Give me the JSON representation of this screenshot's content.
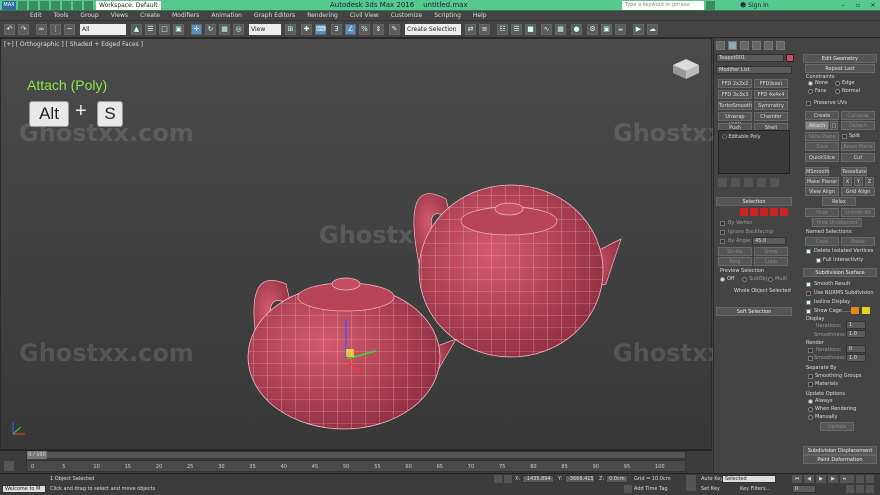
{
  "app": {
    "logo": "MAX",
    "workspace": "Workspace: Default",
    "title": "Autodesk 3ds Max 2016",
    "filename": "untitled.max",
    "search_placeholder": "Type a keyword or phrase",
    "sign_in": "Sign In",
    "window_controls": [
      "–",
      "▫",
      "✕"
    ]
  },
  "menu": [
    "Edit",
    "Tools",
    "Group",
    "Views",
    "Create",
    "Modifiers",
    "Animation",
    "Graph Editors",
    "Rendering",
    "Civil View",
    "Customize",
    "Scripting",
    "Help"
  ],
  "toolbar": {
    "selection_filter": "All",
    "ref_coord": "View",
    "named_selection": "Create Selection Se"
  },
  "viewport": {
    "label": "[+] [ Orthographic ] [ Shaded + Edged Faces ]",
    "overlay_title": "Attach (Poly)",
    "key1": "Alt",
    "key2": "S",
    "watermark": "Ghostxx.com"
  },
  "command_panel": {
    "object_name": "Teapot001",
    "modifier_list": "Modifier List",
    "modifier_buttons": [
      "FFD 2x2x2",
      "FFD(box)",
      "FFD 3x3x3",
      "FFD 4x4x4",
      "TurboSmooth",
      "Symmetry",
      "Unwrap UVW",
      "Chamfer",
      "Push",
      "Shell"
    ],
    "stack_item": "Editable Poly",
    "selection": {
      "header": "Selection",
      "by_vertex": "By Vertex",
      "ignore_backfacing": "Ignore Backfacing",
      "by_angle": "By Angle:",
      "angle_value": "45.0",
      "shrink": "Shrink",
      "grow": "Grow",
      "ring": "Ring",
      "loop": "Loop",
      "preview_selection": "Preview Selection",
      "preview_off": "Off",
      "preview_subobj": "SubObj",
      "preview_multi": "Multi",
      "whole_object": "Whole Object Selected"
    },
    "soft_selection": "Soft Selection",
    "edit_geometry": {
      "header": "Edit Geometry",
      "repeat_last": "Repeat Last",
      "constraints": "Constraints",
      "none": "None",
      "edge": "Edge",
      "face": "Face",
      "normal": "Normal",
      "preserve_uvs": "Preserve UVs",
      "create": "Create",
      "collapse": "Collapse",
      "attach": "Attach",
      "detach": "Detach",
      "slice_plane": "Slice Plane",
      "split": "Split",
      "slice": "Slice",
      "reset_plane": "Reset Plane",
      "quickslice": "QuickSlice",
      "cut": "Cut",
      "msmooth": "MSmooth",
      "tessellate": "Tessellate",
      "make_planar": "Make Planar",
      "x": "X",
      "y": "Y",
      "z": "Z",
      "view_align": "View Align",
      "grid_align": "Grid Align",
      "relax": "Relax",
      "hide_selected": "Hide Selected",
      "unhide_all": "Unhide All",
      "hide_unselected": "Hide Unselected",
      "named_selections": "Named Selections:",
      "copy": "Copy",
      "paste": "Paste",
      "delete_isolated": "Delete Isolated Vertices",
      "full_interactivity": "Full Interactivity"
    },
    "subdivision_surface": {
      "header": "Subdivision Surface",
      "smooth_result": "Smooth Result",
      "use_nurms": "Use NURMS Subdivision",
      "isoline": "Isoline Display",
      "show_cage": "Show Cage......",
      "display": "Display",
      "iterations": "Iterations:",
      "iterations_val": "1",
      "smoothness": "Smoothness:",
      "smoothness_val": "1.0",
      "render": "Render",
      "r_iterations_val": "0",
      "r_smoothness_val": "1.0",
      "separate_by": "Separate By",
      "smoothing_groups": "Smoothing Groups",
      "materials": "Materials",
      "update_options": "Update Options",
      "always": "Always",
      "when_rendering": "When Rendering",
      "manually": "Manually",
      "update": "Update"
    },
    "subdivision_displacement": "Subdivision Displacement",
    "paint_deformation": "Paint Deformation"
  },
  "timeline": {
    "frame": "0 / 100",
    "ticks": [
      "0",
      "5",
      "10",
      "15",
      "20",
      "25",
      "30",
      "35",
      "40",
      "45",
      "50",
      "55",
      "60",
      "65",
      "70",
      "75",
      "80",
      "85",
      "90",
      "95",
      "100"
    ]
  },
  "status": {
    "script_label": "Welcome to M",
    "objects_selected": "1 Object Selected",
    "prompt": "Click and drag to select and move objects",
    "x_label": "X:",
    "x_val": "-1435.894",
    "y_label": "Y:",
    "y_val": "-3666.415",
    "z_label": "Z:",
    "z_val": "0.0cm",
    "grid": "Grid = 10.0cm",
    "add_time_tag": "Add Time Tag",
    "auto_key": "Auto Key",
    "set_key": "Set Key",
    "key_mode": "Selected",
    "key_filters": "Key Filters...",
    "frame_field": "0"
  },
  "colors": {
    "titlebar": "#58c98e",
    "teapot": "#c0485e",
    "overlay_text": "#8be84a"
  }
}
